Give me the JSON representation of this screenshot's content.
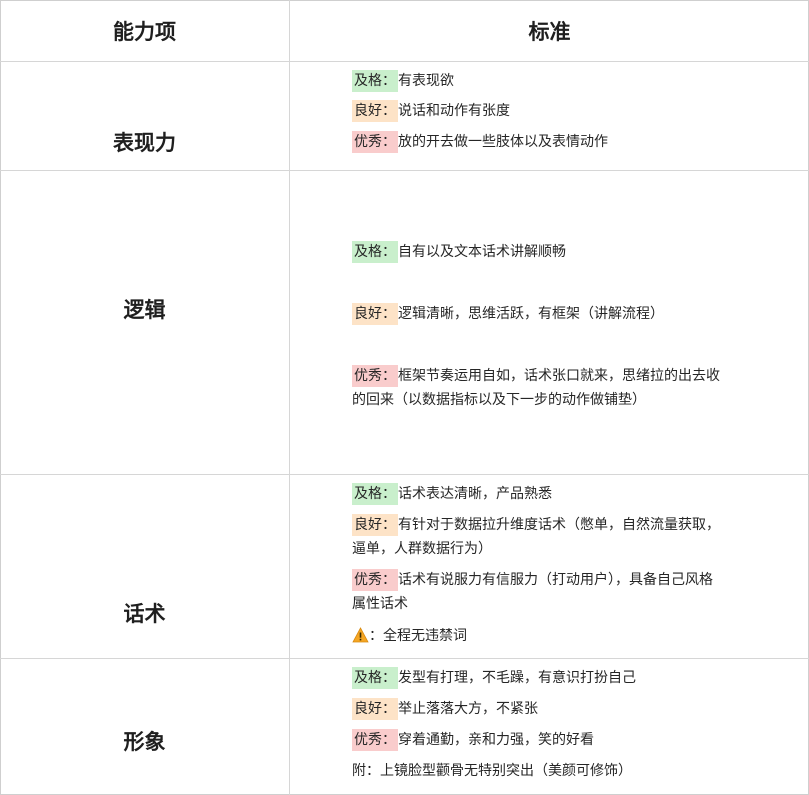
{
  "header": {
    "col_ability": "能力项",
    "col_standard": "标准"
  },
  "rows": [
    {
      "ability": "表现力",
      "pass_label": "及格：",
      "pass_text": "有表现欲",
      "good_label": "良好：",
      "good_text": "说话和动作有张度",
      "excellent_label": "优秀：",
      "excellent_text": "放的开去做一些肢体以及表情动作"
    },
    {
      "ability": "逻辑",
      "pass_label": "及格：",
      "pass_text": "自有以及文本话术讲解顺畅",
      "good_label": "良好：",
      "good_text": "逻辑清晰，思维活跃，有框架（讲解流程）",
      "excellent_label": "优秀：",
      "excellent_text_1": "框架节奏运用自如，话术张口就来，思绪拉的出去收",
      "excellent_text_2": "的回来（以数据指标以及下一步的动作做铺垫）"
    },
    {
      "ability": "话术",
      "pass_label": "及格：",
      "pass_text": "话术表达清晰，产品熟悉",
      "good_label": "良好：",
      "good_text_1": "有针对于数据拉升维度话术（憋单，自然流量获取，",
      "good_text_2": "逼单，人群数据行为）",
      "excellent_label": "优秀：",
      "excellent_text_1": "话术有说服力有信服力（打动用户），具备自己风格",
      "excellent_text_2": "属性话术",
      "warning_text": "：全程无违禁词"
    },
    {
      "ability": "形象",
      "pass_label": "及格：",
      "pass_text": "发型有打理，不毛躁，有意识打扮自己",
      "good_label": "良好：",
      "good_text": "举止落落大方，不紧张",
      "excellent_label": "优秀：",
      "excellent_text": "穿着通勤，亲和力强，笑的好看",
      "note_text": "附：上镜脸型颧骨无特别突出（美颜可修饰）"
    }
  ],
  "colors": {
    "pass": "#c9efcc",
    "good": "#fde3c7",
    "excellent": "#f9cccc",
    "warning": "#f5a623"
  }
}
